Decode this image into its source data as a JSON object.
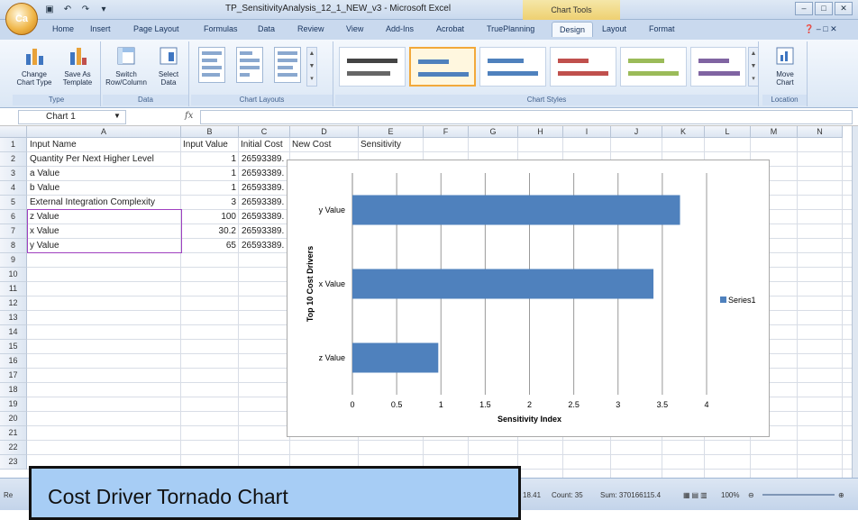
{
  "window": {
    "title": "TP_SensitivityAnalysis_12_1_NEW_v3 - Microsoft Excel",
    "context_tab_group": "Chart Tools",
    "office_button": "Ca"
  },
  "ribbon_tabs": [
    "Home",
    "Insert",
    "Page Layout",
    "Formulas",
    "Data",
    "Review",
    "View",
    "Add-Ins",
    "Acrobat",
    "TruePlanning",
    "Design",
    "Layout",
    "Format"
  ],
  "ribbon": {
    "type_group": {
      "label": "Type",
      "change": "Change\nChart Type",
      "save": "Save As\nTemplate"
    },
    "data_group": {
      "label": "Data",
      "switch": "Switch\nRow/Column",
      "select": "Select\nData"
    },
    "layouts_group": {
      "label": "Chart Layouts"
    },
    "styles_group": {
      "label": "Chart Styles"
    },
    "location_group": {
      "label": "Location",
      "move": "Move\nChart"
    }
  },
  "formula_bar": {
    "name_box": "Chart 1",
    "fx": "fx"
  },
  "columns": [
    "A",
    "B",
    "C",
    "D",
    "E",
    "F",
    "G",
    "H",
    "I",
    "J",
    "K",
    "L",
    "M",
    "N"
  ],
  "rows": [
    "1",
    "2",
    "3",
    "4",
    "5",
    "6",
    "7",
    "8",
    "9",
    "10",
    "11",
    "12",
    "13",
    "14",
    "15",
    "16",
    "17",
    "18",
    "19",
    "20",
    "21",
    "22",
    "23"
  ],
  "headers": {
    "a": "Input Name",
    "b": "Input Value",
    "c": "Initial Cost",
    "d": "New Cost",
    "e": "Sensitivity"
  },
  "table": [
    {
      "name": "Quantity Per Next Higher Level",
      "value": "1",
      "cost": "26593389."
    },
    {
      "name": "a Value",
      "value": "1",
      "cost": "26593389."
    },
    {
      "name": "b Value",
      "value": "1",
      "cost": "26593389."
    },
    {
      "name": "External Integration Complexity",
      "value": "3",
      "cost": "26593389."
    },
    {
      "name": "z Value",
      "value": "100",
      "cost": "26593389."
    },
    {
      "name": "x Value",
      "value": "30.2",
      "cost": "26593389."
    },
    {
      "name": "y Value",
      "value": "65",
      "cost": "26593389."
    }
  ],
  "chart_data": {
    "type": "bar",
    "orientation": "horizontal",
    "categories": [
      "y Value",
      "x Value",
      "z Value"
    ],
    "series": [
      {
        "name": "Series1",
        "values": [
          3.7,
          3.4,
          0.97
        ]
      }
    ],
    "xlabel": "Sensitivity Index",
    "ylabel": "Top 10 Cost Drivers",
    "xlim": [
      0,
      4
    ],
    "xticks": [
      "0",
      "0.5",
      "1",
      "1.5",
      "2",
      "2.5",
      "3",
      "3.5",
      "4"
    ],
    "grid": true,
    "legend": "right",
    "bar_color": "#4f81bd"
  },
  "status": {
    "ready": "Re",
    "average_tail": "18.41",
    "count": "Count: 35",
    "sum": "Sum: 370166115.4",
    "zoom": "100%"
  },
  "callout": {
    "text": "Cost Driver Tornado Chart"
  }
}
